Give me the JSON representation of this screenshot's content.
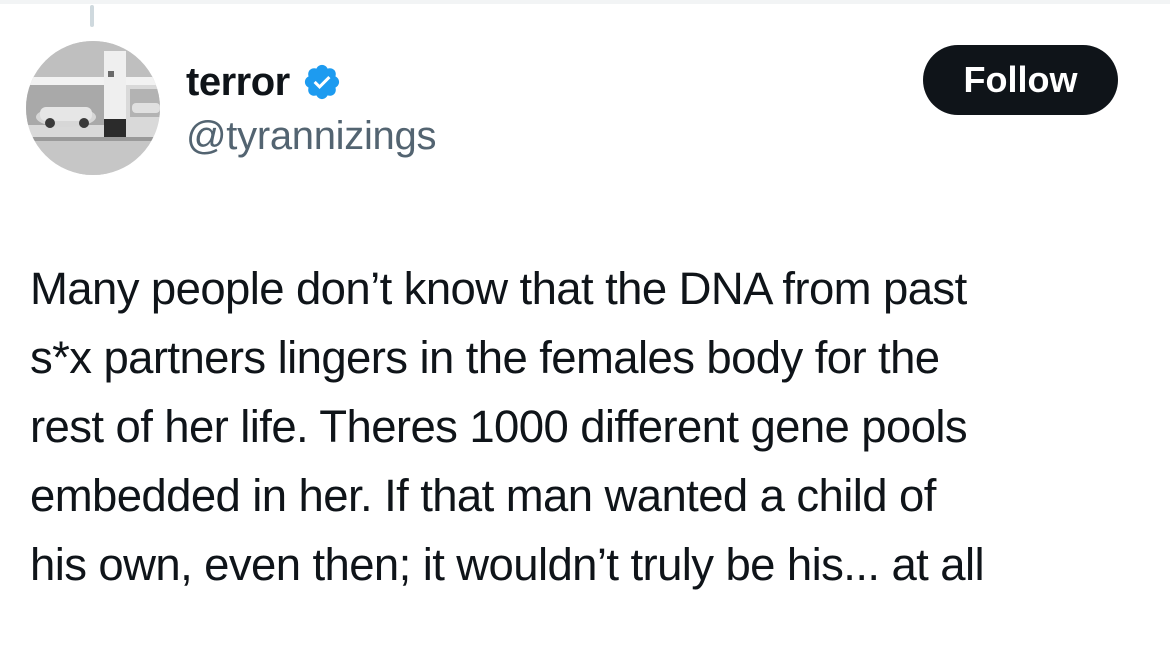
{
  "author": {
    "display_name": "terror",
    "handle": "@tyrannizings",
    "verified": true,
    "avatar": "avatar-parking-garage-cars"
  },
  "follow_button": {
    "label": "Follow"
  },
  "tweet": {
    "lines": [
      "Many people don’t know that the DNA from past",
      "s*x partners lingers in the females body for the",
      "rest of her life. Theres 1000 different gene pools",
      "embedded in her. If that man wanted a child of",
      "his own, even then; it wouldn’t truly be his... at all"
    ]
  },
  "colors": {
    "verified_badge": "#1d9bf0",
    "follow_button_bg": "#0f1419",
    "follow_button_text": "#ffffff",
    "handle_text": "#536471",
    "body_text": "#0f1419",
    "thread_line": "#cfd9de"
  }
}
